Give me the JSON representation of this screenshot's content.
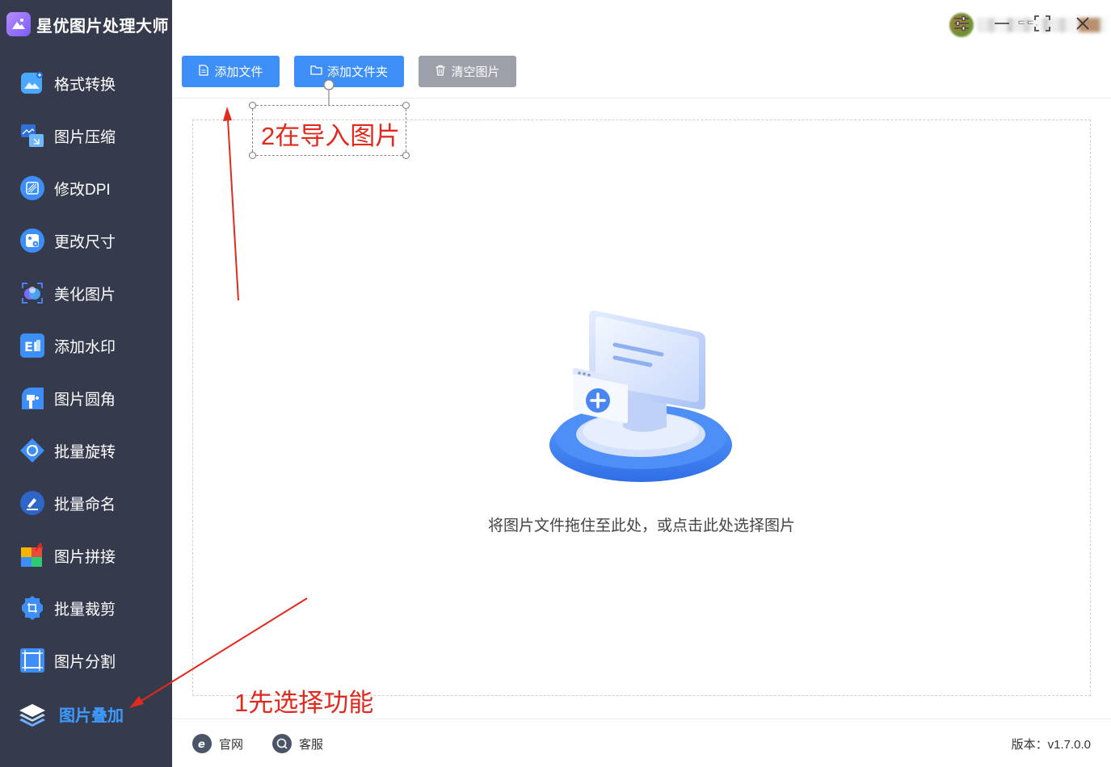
{
  "app": {
    "title": "星优图片处理大师"
  },
  "sidebar": {
    "items": [
      {
        "label": "格式转换",
        "icon": "image-convert-icon"
      },
      {
        "label": "图片压缩",
        "icon": "image-compress-icon"
      },
      {
        "label": "修改DPI",
        "icon": "dpi-icon"
      },
      {
        "label": "更改尺寸",
        "icon": "resize-icon"
      },
      {
        "label": "美化图片",
        "icon": "beautify-icon"
      },
      {
        "label": "添加水印",
        "icon": "watermark-icon"
      },
      {
        "label": "图片圆角",
        "icon": "rounded-corner-icon"
      },
      {
        "label": "批量旋转",
        "icon": "rotate-icon"
      },
      {
        "label": "批量命名",
        "icon": "rename-icon"
      },
      {
        "label": "图片拼接",
        "icon": "puzzle-icon"
      },
      {
        "label": "批量裁剪",
        "icon": "crop-icon"
      },
      {
        "label": "图片分割",
        "icon": "split-icon"
      },
      {
        "label": "图片叠加",
        "icon": "layers-icon",
        "active": true
      }
    ]
  },
  "header": {
    "username": "ᄃᄃ·"
  },
  "toolbar": {
    "add_file": "添加文件",
    "add_folder": "添加文件夹",
    "clear": "清空图片"
  },
  "dropzone": {
    "hint": "将图片文件拖住至此处，或点击此处选择图片"
  },
  "footer": {
    "website": "官网",
    "support": "客服",
    "version": "版本：v1.7.0.0"
  },
  "annotations": {
    "step1": "1先选择功能",
    "step2": "2在导入图片"
  },
  "colors": {
    "sidebar_bg": "#353b4c",
    "accent": "#3d8ef7",
    "annotation": "#e02a1f"
  }
}
